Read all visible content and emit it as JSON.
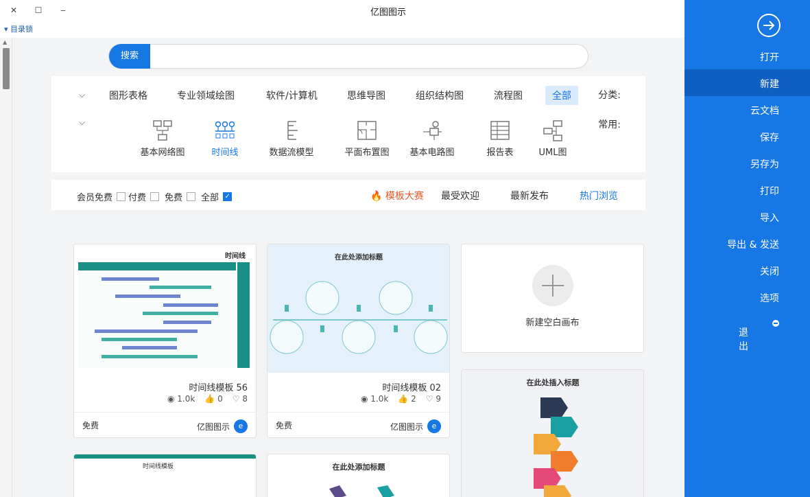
{
  "window": {
    "title": "亿图图示",
    "close_label": "✕",
    "maximize_label": "☐",
    "minimize_label": "‒",
    "user_menu": "▾ 目录锁"
  },
  "search": {
    "button_label": "搜索",
    "placeholder": ""
  },
  "categories": {
    "label": "分类:",
    "items": [
      "全部",
      "流程图",
      "组织结构图",
      "思维导图",
      "软件/计算机",
      "专业领域绘图",
      "图形表格"
    ],
    "active_index": 0
  },
  "common": {
    "label": "常用:",
    "items": [
      {
        "label": "UML图",
        "icon": "uml-icon"
      },
      {
        "label": "报告表",
        "icon": "report-icon"
      },
      {
        "label": "基本电路图",
        "icon": "circuit-icon"
      },
      {
        "label": "平面布置图",
        "icon": "floorplan-icon"
      },
      {
        "label": "数据流模型",
        "icon": "dataflow-icon"
      },
      {
        "label": "时间线",
        "icon": "timeline-icon"
      },
      {
        "label": "基本网络图",
        "icon": "network-icon"
      }
    ],
    "active_index": 5
  },
  "sort": {
    "items": [
      "热门浏览",
      "最新发布",
      "最受欢迎",
      "模板大赛"
    ],
    "active_index": 0,
    "hot_index": 3
  },
  "filters": {
    "items": [
      "全部",
      "免费",
      "付费",
      "会员免费"
    ],
    "checked_index": 0
  },
  "blank_card": {
    "label": "新建空白画布"
  },
  "cards": [
    {
      "name": "时间线模板 02",
      "views": "1.0k",
      "likes": "2",
      "favorites": "9",
      "brand": "亿图图示",
      "price": "免费",
      "thumb_title": "在此处添加标题"
    },
    {
      "name": "时间线模板 56",
      "views": "1.0k",
      "likes": "0",
      "favorites": "8",
      "brand": "亿图图示",
      "price": "免费",
      "thumb_title": "时间线"
    }
  ],
  "partial_cards": [
    {
      "thumb_title": "在此处插入标题"
    },
    {
      "thumb_title": "在此处添加标题"
    },
    {
      "thumb_title": "时间线模板"
    }
  ],
  "sidebar": {
    "items": [
      "打开",
      "新建",
      "云文档",
      "保存",
      "另存为",
      "打印",
      "导入",
      "导出 & 发送",
      "关闭",
      "选项",
      "退出"
    ],
    "active_index": 1
  },
  "colors": {
    "accent": "#1677e5",
    "sidebar_active": "#0f5fc2",
    "hot": "#e45b2b",
    "teal": "#1a8f86"
  }
}
